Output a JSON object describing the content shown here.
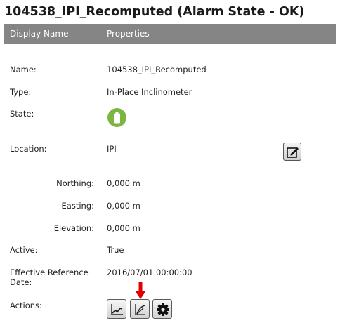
{
  "title": "104538_IPI_Recomputed (Alarm State - OK)",
  "header": {
    "col1": "Display Name",
    "col2": "Properties"
  },
  "fields": {
    "name": {
      "label": "Name:",
      "value": "104538_IPI_Recomputed"
    },
    "type": {
      "label": "Type:",
      "value": "In-Place Inclinometer"
    },
    "state": {
      "label": "State:",
      "icon": "battery-ok-icon",
      "color": "#7cb540"
    },
    "location": {
      "label": "Location:",
      "value": "IPI"
    },
    "northing": {
      "label": "Northing:",
      "value": "0,000 m"
    },
    "easting": {
      "label": "Easting:",
      "value": "0,000 m"
    },
    "elevation": {
      "label": "Elevation:",
      "value": "0,000 m"
    },
    "active": {
      "label": "Active:",
      "value": "True"
    },
    "ref_date": {
      "label": "Effective Reference Date:",
      "value": "2016/07/01 00:00:00"
    },
    "actions": {
      "label": "Actions:"
    }
  },
  "action_icons": [
    "line-chart-icon",
    "inclinometer-profile-icon",
    "settings-gear-icon"
  ],
  "accent": {
    "header_bg": "#858585",
    "arrow": "#e00000"
  }
}
